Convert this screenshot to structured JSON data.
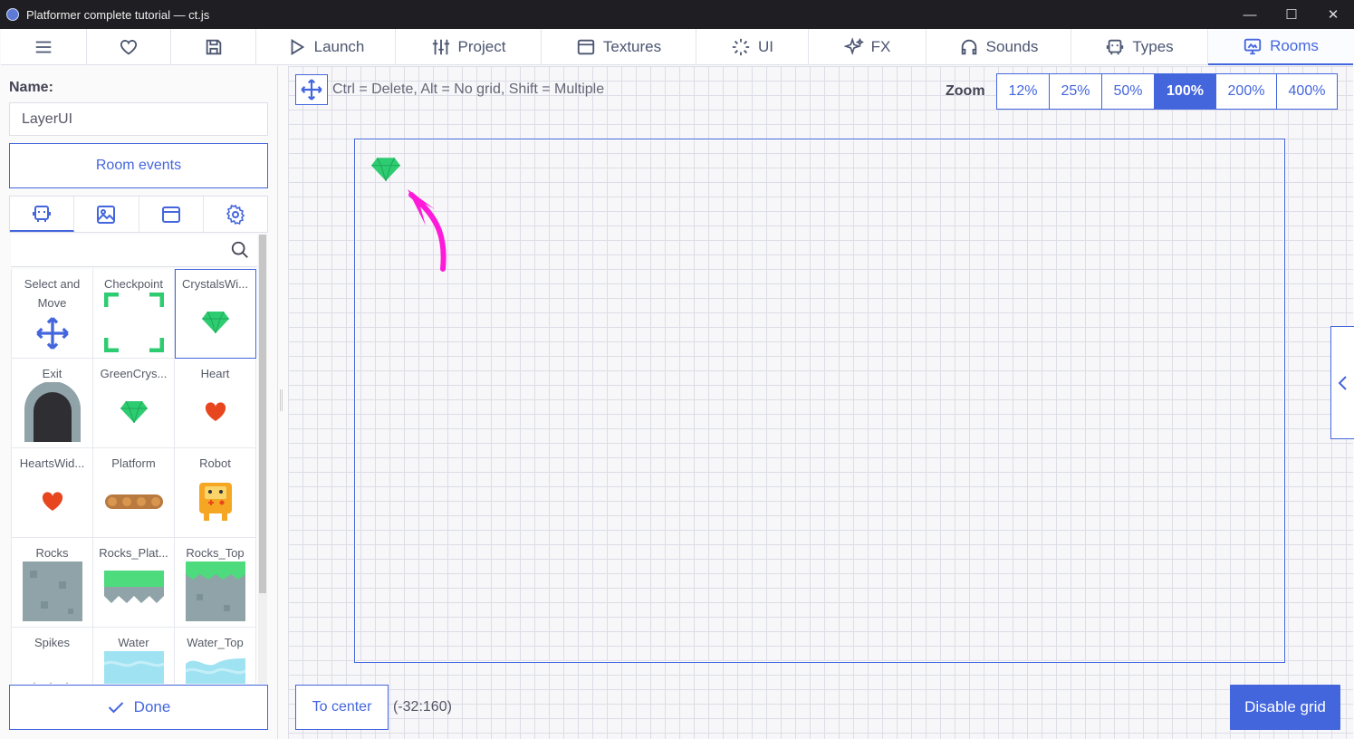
{
  "window": {
    "title": "Platformer complete tutorial — ct.js",
    "controls": [
      "minimize-icon",
      "maximize-icon",
      "close-icon"
    ]
  },
  "nav": {
    "icons": [
      "menu-icon",
      "heart-icon",
      "save-icon"
    ],
    "tabs": [
      {
        "label": "Launch",
        "icon": "play-icon"
      },
      {
        "label": "Project",
        "icon": "sliders-icon"
      },
      {
        "label": "Textures",
        "icon": "texture-icon"
      },
      {
        "label": "UI",
        "icon": "ui-icon"
      },
      {
        "label": "FX",
        "icon": "sparkles-icon"
      },
      {
        "label": "Sounds",
        "icon": "headphones-icon"
      },
      {
        "label": "Types",
        "icon": "robot-icon"
      },
      {
        "label": "Rooms",
        "icon": "rooms-icon",
        "active": true
      }
    ]
  },
  "left": {
    "name_label": "Name:",
    "name_value": "LayerUI",
    "room_events_label": "Room events",
    "subtabs": [
      "robot-icon",
      "image-icon",
      "texture-icon",
      "gear-icon"
    ],
    "search_placeholder": "",
    "items": [
      {
        "label": "Select and Move",
        "thumb": "move-icon"
      },
      {
        "label": "Checkpoint",
        "thumb": "checkpoint"
      },
      {
        "label": "CrystalsWi...",
        "thumb": "gem",
        "selected": true
      },
      {
        "label": "Exit",
        "thumb": "door"
      },
      {
        "label": "GreenCrys...",
        "thumb": "gem"
      },
      {
        "label": "Heart",
        "thumb": "heart"
      },
      {
        "label": "HeartsWid...",
        "thumb": "heart"
      },
      {
        "label": "Platform",
        "thumb": "platform"
      },
      {
        "label": "Robot",
        "thumb": "robot"
      },
      {
        "label": "Rocks",
        "thumb": "rocks"
      },
      {
        "label": "Rocks_Plat...",
        "thumb": "rocks-plat"
      },
      {
        "label": "Rocks_Top",
        "thumb": "rocks-top"
      },
      {
        "label": "Spikes",
        "thumb": "spikes"
      },
      {
        "label": "Water",
        "thumb": "water"
      },
      {
        "label": "Water_Top",
        "thumb": "water-top"
      }
    ],
    "done_label": "Done"
  },
  "editor": {
    "hint": "Ctrl = Delete, Alt = No grid, Shift = Multiple",
    "zoom_label": "Zoom",
    "zoom_levels": [
      "12%",
      "25%",
      "50%",
      "100%",
      "200%",
      "400%"
    ],
    "zoom_active": "100%",
    "to_center_label": "To center",
    "coords": "(-32:160)",
    "disable_grid_label": "Disable grid"
  },
  "colors": {
    "accent": "#4466dd",
    "gem": "#2ecc71",
    "heart": "#e8461e",
    "annotation_arrow": "#ff1ad9"
  }
}
